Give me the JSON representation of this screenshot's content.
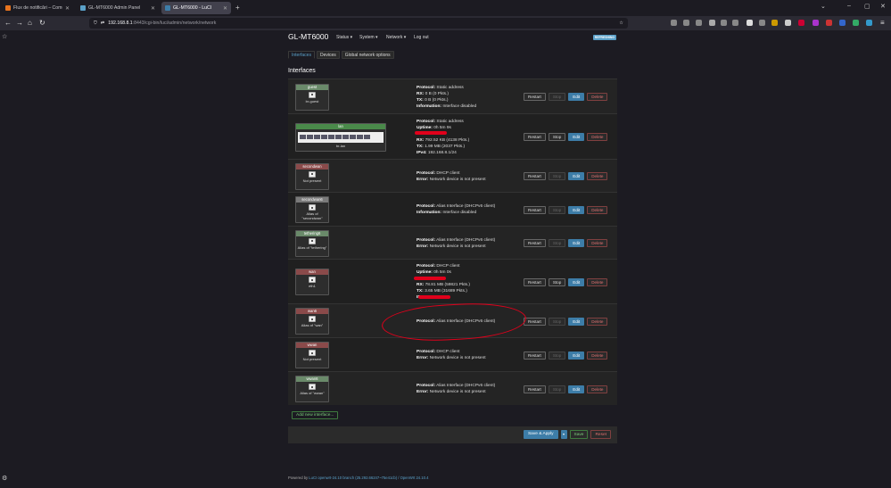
{
  "browser": {
    "tabs": [
      {
        "title": "Flux de notificări – Comunitatea",
        "active": false,
        "color": "#e8741e"
      },
      {
        "title": "GL-MT6000 Admin Panel",
        "active": false,
        "color": "#5aa0c8"
      },
      {
        "title": "GL-MT6000 - LuCI",
        "active": true,
        "color": "#3d7da8"
      }
    ],
    "url_host": "192.168.8.1",
    "url_path": ":8443/cgi-bin/luci/admin/network/network",
    "new_tab": "+"
  },
  "header": {
    "brand": "GL-MT6000",
    "menu": [
      "Status ▾",
      "System ▾",
      "Network ▾",
      "Log out"
    ],
    "refresh": "REFRESHING"
  },
  "subtabs": [
    "Interfaces",
    "Devices",
    "Global network options"
  ],
  "section_title": "Interfaces",
  "interfaces": [
    {
      "name": "guest",
      "head_color": "#6a8a6a",
      "device": "br-guest",
      "lines": [
        [
          "Protocol:",
          "Static address"
        ],
        [
          "RX:",
          "0 B (0 Pkts.)"
        ],
        [
          "TX:",
          "0 B (0 Pkts.)"
        ],
        [
          "Information:",
          "Interface disabled"
        ]
      ],
      "stop_enabled": false
    },
    {
      "name": "lan",
      "head_color": "#4a8a4a",
      "device": "br-lan",
      "lines": [
        [
          "Protocol:",
          "Static address"
        ],
        [
          "Uptime:",
          "0h 5m 9s"
        ],
        [
          "MAC:",
          "9 … B9"
        ],
        [
          "RX:",
          "792.52 KB (4138 Pkts.)"
        ],
        [
          "TX:",
          "1.99 MB (2037 Pkts.)"
        ],
        [
          "IPv4:",
          "192.168.8.1/24"
        ]
      ],
      "stop_enabled": true
    },
    {
      "name": "secondwan",
      "head_color": "#8a4a4a",
      "device": "Not present",
      "lines": [
        [
          "Protocol:",
          "DHCP client"
        ],
        [
          "Error:",
          "Network device is not present"
        ]
      ],
      "stop_enabled": false
    },
    {
      "name": "secondwan6",
      "head_color": "#7a7a7a",
      "device": "Alias of \"secondwan\"",
      "lines": [
        [
          "Protocol:",
          "Alias Interface (DHCPv6 client)"
        ],
        [
          "Information:",
          "Interface disabled"
        ]
      ],
      "stop_enabled": false
    },
    {
      "name": "tethering6",
      "head_color": "#6a8a6a",
      "device": "Alias of \"tethering\"",
      "lines": [
        [
          "Protocol:",
          "Alias Interface (DHCPv6 client)"
        ],
        [
          "Error:",
          "Network device is not present"
        ]
      ],
      "stop_enabled": false
    },
    {
      "name": "wan",
      "head_color": "#8a4a4a",
      "device": "eth1",
      "lines": [
        [
          "Protocol:",
          "DHCP client"
        ],
        [
          "Uptime:",
          "0h 5m 0s"
        ],
        [
          "MAC:",
          "9 … 37"
        ],
        [
          "RX:",
          "78.81 MB (59821 Pkts.)"
        ],
        [
          "TX:",
          "3.65 MB (31689 Pkts.)"
        ],
        [
          "IPv4:",
          "90 … 220"
        ]
      ],
      "stop_enabled": true
    },
    {
      "name": "wan6",
      "head_color": "#8a4a4a",
      "device": "Alias of \"wan\"",
      "lines": [
        [
          "Protocol:",
          "Alias Interface (DHCPv6 client)"
        ]
      ],
      "stop_enabled": false
    },
    {
      "name": "wwan",
      "head_color": "#8a4a4a",
      "device": "Not present",
      "lines": [
        [
          "Protocol:",
          "DHCP client"
        ],
        [
          "Error:",
          "Network device is not present"
        ]
      ],
      "stop_enabled": false
    },
    {
      "name": "wwan6",
      "head_color": "#6a8a6a",
      "device": "Alias of \"wwan\"",
      "lines": [
        [
          "Protocol:",
          "Alias Interface (DHCPv6 client)"
        ],
        [
          "Error:",
          "Network device is not present"
        ]
      ],
      "stop_enabled": false
    }
  ],
  "buttons": {
    "restart": "Restart",
    "stop": "Stop",
    "edit": "Edit",
    "delete": "Delete"
  },
  "add_interface": "Add new interface...",
  "footer_buttons": {
    "save_apply": "Save & Apply",
    "dropdown": "▾",
    "save": "Save",
    "reset": "Reset"
  },
  "powered_by": {
    "prefix": "Powered by ",
    "link": "LuCI openwrt-24.10 branch (25.292.66247~75e41cb) / OpenWrt 24.10.4"
  }
}
